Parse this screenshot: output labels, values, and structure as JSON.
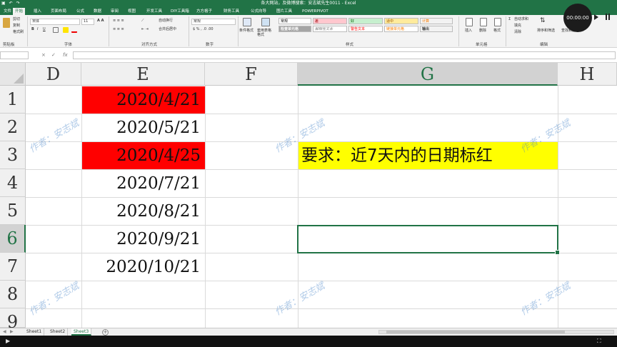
{
  "window": {
    "title": "各大网站，及微博搜索：安志斌先生0011 - Excel",
    "qat": [
      "save",
      "undo",
      "redo"
    ]
  },
  "ribbon_tabs": [
    "文件",
    "开始",
    "插入",
    "页面布局",
    "公式",
    "数据",
    "审阅",
    "视图",
    "开发工具",
    "DIY工具箱",
    "方方格子",
    "财务工具",
    "公式向导",
    "图片工具",
    "POWERPIVOT"
  ],
  "ribbon": {
    "clipboard": {
      "cut": "剪切",
      "copy": "复制",
      "format_painter": "格式刷",
      "label": "剪贴板"
    },
    "font": {
      "name": "宋体",
      "size": "11",
      "label": "字体"
    },
    "alignment": {
      "wrap": "自动换行",
      "merge": "合并后居中",
      "label": "对齐方式"
    },
    "number": {
      "format": "常规",
      "label": "数字"
    },
    "styles": {
      "conditional": "条件格式",
      "table": "套用表格格式",
      "cells": [
        "常规",
        "差",
        "好",
        "适中",
        "计算",
        "检查单元格",
        "解释性文本",
        "警告文本",
        "链接单元格",
        "输出"
      ],
      "label": "样式"
    },
    "cells": {
      "insert": "插入",
      "delete": "删除",
      "format": "格式",
      "label": "单元格"
    },
    "editing": {
      "autosum": "自动求和",
      "fill": "填充",
      "clear": "清除",
      "sort": "排序和筛选",
      "find": "查找和选择",
      "label": "编辑"
    }
  },
  "timer": "00:00:00",
  "formula_bar": {
    "name_box": "",
    "cancel": "×",
    "enter": "✓",
    "fx": "fx",
    "value": ""
  },
  "columns": [
    "D",
    "E",
    "F",
    "G",
    "H"
  ],
  "rows": [
    "1",
    "2",
    "3",
    "4",
    "5",
    "6",
    "7",
    "8",
    "9"
  ],
  "cells": {
    "e1": "2020/4/21",
    "e2": "2020/5/21",
    "e3": "2020/4/25",
    "e4": "2020/7/21",
    "e5": "2020/8/21",
    "e6": "2020/9/21",
    "e7": "2020/10/21",
    "g3": "要求：近7天内的日期标红"
  },
  "colors": {
    "accent": "#217346",
    "highlight_red": "#ff0000",
    "highlight_yellow": "#ffff00"
  },
  "watermark": "作者：安志斌",
  "sheets": [
    "Sheet1",
    "Sheet2",
    "Sheet3"
  ],
  "active_sheet": "Sheet3"
}
